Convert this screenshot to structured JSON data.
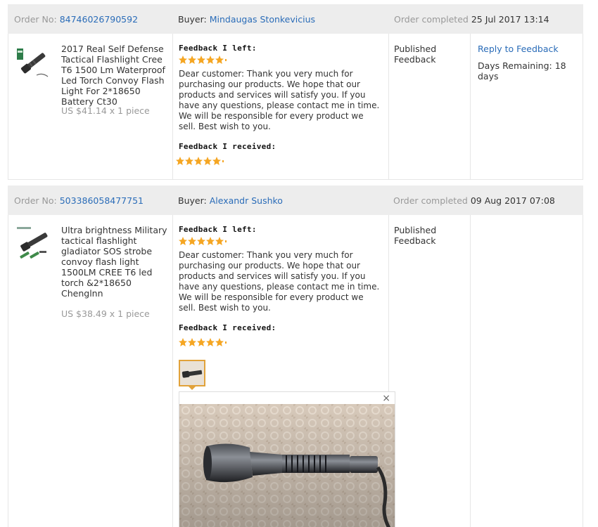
{
  "orders": [
    {
      "order_no_label": "Order No:",
      "order_no": "84746026790592",
      "buyer_label": "Buyer:",
      "buyer_name": "Mindaugas Stonkevicius",
      "completed_label": "Order completed",
      "completed_date": "25 Jul 2017 13:14",
      "product_title": "2017 Real Self Defense Tactical Flashlight Cree T6 1500 Lm Waterproof Led Torch Convoy Flash Light For 2*18650 Battery Ct30",
      "price": "US $41.14 x 1 piece",
      "feedback_left_label": "Feedback I left:",
      "feedback_left_stars": 5,
      "feedback_text": "Dear customer: Thank you very much for purchasing our products. We hope that our products and services will satisfy you. If you have any questions, please contact me in time. We will be responsible for every product we sell. Best wish to you.",
      "feedback_received_label": "Feedback I received:",
      "feedback_received_stars": 5,
      "status_line1": "Published",
      "status_line2": "Feedback",
      "reply_link": "Reply to Feedback",
      "days_remaining": "Days Remaining: 18 days"
    },
    {
      "order_no_label": "Order No:",
      "order_no": "503386058477751",
      "buyer_label": "Buyer:",
      "buyer_name": "Alexandr Sushko",
      "completed_label": "Order completed",
      "completed_date": "09 Aug 2017 07:08",
      "product_title": "Ultra brightness Military tactical flashlight gladiator SOS strobe convoy flash light 1500LM CREE T6 led torch &2*18650 Chenglnn",
      "price": "US $38.49 x 1 piece",
      "feedback_left_label": "Feedback I left:",
      "feedback_left_stars": 5,
      "feedback_text": "Dear customer: Thank you very much for purchasing our products. We hope that our products and services will satisfy you. If you have any questions, please contact me in time. We will be responsible for every product we sell. Best wish to you.",
      "feedback_received_label": "Feedback I received:",
      "feedback_received_stars": 5,
      "status_line1": "Published",
      "status_line2": "Feedback",
      "preview_close": "×"
    }
  ],
  "colors": {
    "link": "#2a6cb8",
    "star": "#f5a623",
    "header_bg": "#ededed"
  },
  "icons": {
    "star": "star-icon",
    "close": "close-icon"
  }
}
